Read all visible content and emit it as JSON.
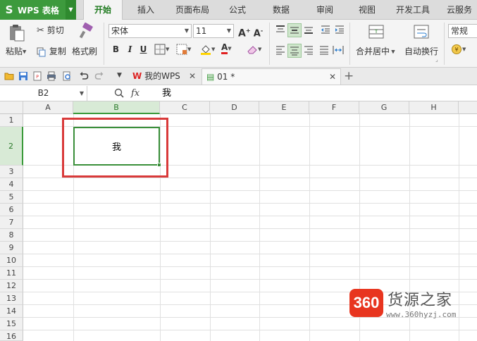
{
  "app": {
    "name": "WPS 表格",
    "logo_letter": "S"
  },
  "ribbon_tabs": [
    "开始",
    "插入",
    "页面布局",
    "公式",
    "数据",
    "审阅",
    "视图",
    "开发工具",
    "云服务"
  ],
  "active_tab": "开始",
  "ribbon": {
    "paste": "粘贴",
    "cut": "剪切",
    "copy": "复制",
    "format_painter": "格式刷",
    "font_name": "宋体",
    "font_size": "11",
    "bold": "B",
    "italic": "I",
    "underline": "U",
    "merge_center": "合并居中",
    "wrap_text": "自动换行",
    "number_format": "常规"
  },
  "doc_tabs": [
    {
      "label": "我的WPS",
      "active": false
    },
    {
      "label": "01 *",
      "active": true
    }
  ],
  "formula_bar": {
    "cell_ref": "B2",
    "fx": "fx",
    "content": "我"
  },
  "columns": [
    "A",
    "B",
    "C",
    "D",
    "E",
    "F",
    "G",
    "H"
  ],
  "rows": [
    "1",
    "2",
    "3",
    "4",
    "5",
    "6",
    "7",
    "8",
    "9",
    "10",
    "11",
    "12",
    "13",
    "14",
    "15",
    "16"
  ],
  "selected_cell": {
    "ref": "B2",
    "value": "我"
  },
  "watermark": {
    "badge": "360",
    "name": "货源之家",
    "url": "www.360hyzj.com"
  }
}
